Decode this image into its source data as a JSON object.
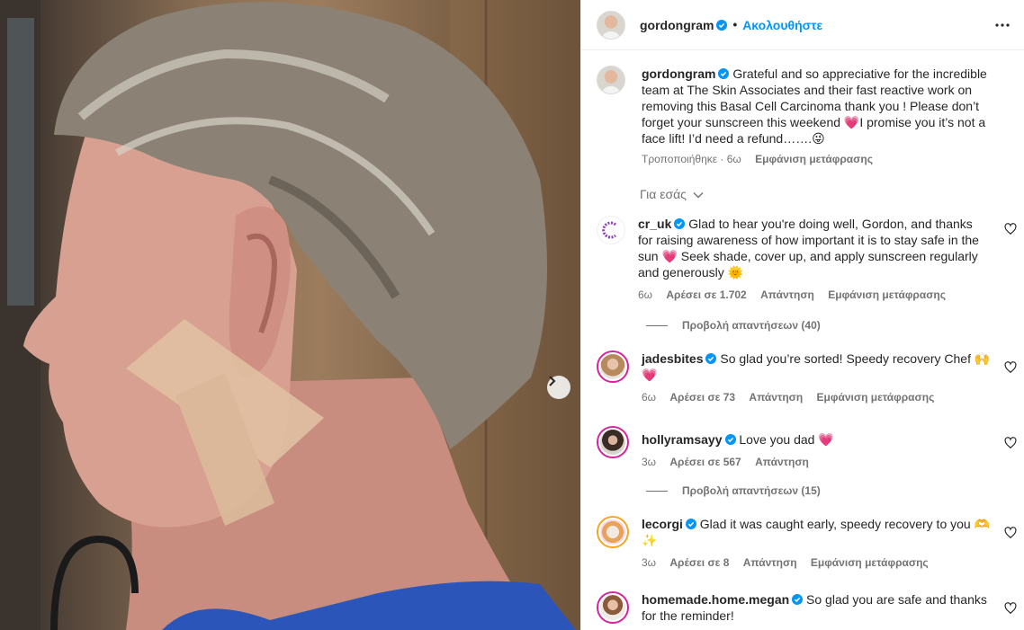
{
  "post": {
    "author": "gordongram",
    "follow_label": "Ακολουθήστε",
    "separator": "•",
    "caption_author": "gordongram",
    "caption_text": "Grateful and so appreciative for the incredible team at The Skin Associates and their fast reactive work on removing this Basal Cell Carcinoma thank you ! Please don’t forget your sunscreen this weekend 💗I promise you it’s not a face lift! I’d need a refund…….😜",
    "caption_meta_edited": "Τροποποιήθηκε · 6ω",
    "caption_translate": "Εμφάνιση μετάφρασης",
    "for_you": "Για εσάς"
  },
  "comments": [
    {
      "username": "cr_uk",
      "text": "Glad to hear you're doing well, Gordon, and thanks for raising awareness of how important it is to stay safe in the sun 💗 Seek shade, cover up, and apply sunscreen regularly and generously 🌞",
      "time": "6ω",
      "likes": "Αρέσει σε 1.702",
      "reply": "Απάντηση",
      "translate": "Εμφάνιση μετάφρασης",
      "view_replies": "Προβολή απαντήσεων (40)"
    },
    {
      "username": "jadesbites",
      "text": "So glad you’re sorted! Speedy recovery Chef 🙌 💗",
      "time": "6ω",
      "likes": "Αρέσει σε 73",
      "reply": "Απάντηση",
      "translate": "Εμφάνιση μετάφρασης"
    },
    {
      "username": "hollyramsayy",
      "text": "Love you dad 💗",
      "time": "3ω",
      "likes": "Αρέσει σε 567",
      "reply": "Απάντηση",
      "view_replies": "Προβολή απαντήσεων (15)"
    },
    {
      "username": "lecorgi",
      "text": "Glad it was caught early, speedy recovery to you 🫶 ✨",
      "time": "3ω",
      "likes": "Αρέσει σε 8",
      "reply": "Απάντηση",
      "translate": "Εμφάνιση μετάφρασης"
    },
    {
      "username": "homemade.home.megan",
      "text": "So glad you are safe and thanks for the reminder!"
    }
  ],
  "colors": {
    "link": "#0095f6",
    "verified": "#0095f6",
    "muted": "#737373",
    "text": "#262626"
  },
  "icons": {
    "more": "more-horizontal-icon",
    "heart": "heart-outline-icon",
    "verified": "verified-badge-icon",
    "next": "chevron-right-icon",
    "chevron_down": "chevron-down-icon"
  }
}
